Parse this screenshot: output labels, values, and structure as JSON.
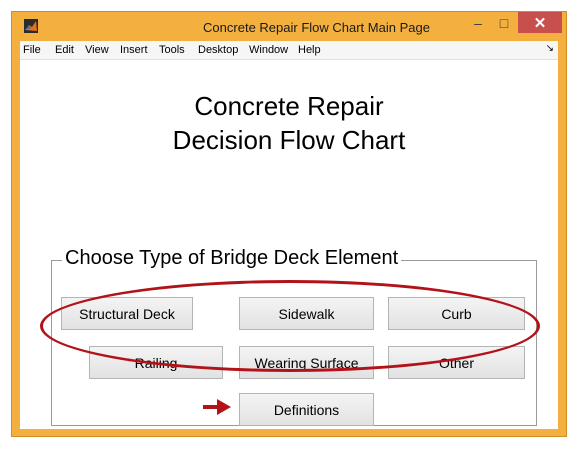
{
  "window": {
    "title": "Concrete Repair Flow Chart Main Page",
    "min_symbol": "–",
    "max_symbol": "□",
    "close_symbol": "✕",
    "accent_color": "#f3b03f"
  },
  "menubar": {
    "items": [
      "File",
      "Edit",
      "View",
      "Insert",
      "Tools",
      "Desktop",
      "Window",
      "Help"
    ],
    "overflow_symbol": "↘"
  },
  "main": {
    "title_line1": "Concrete Repair",
    "title_line2": "Decision Flow Chart",
    "group_label": "Choose Type of Bridge Deck Element",
    "buttons": {
      "structural_deck": "Structural Deck",
      "sidewalk": "Sidewalk",
      "curb": "Curb",
      "railing": "Railing",
      "wearing_surface": "Wearing Surface",
      "other": "Other",
      "definitions": "Definitions"
    },
    "annotation_color": "#b21319"
  }
}
